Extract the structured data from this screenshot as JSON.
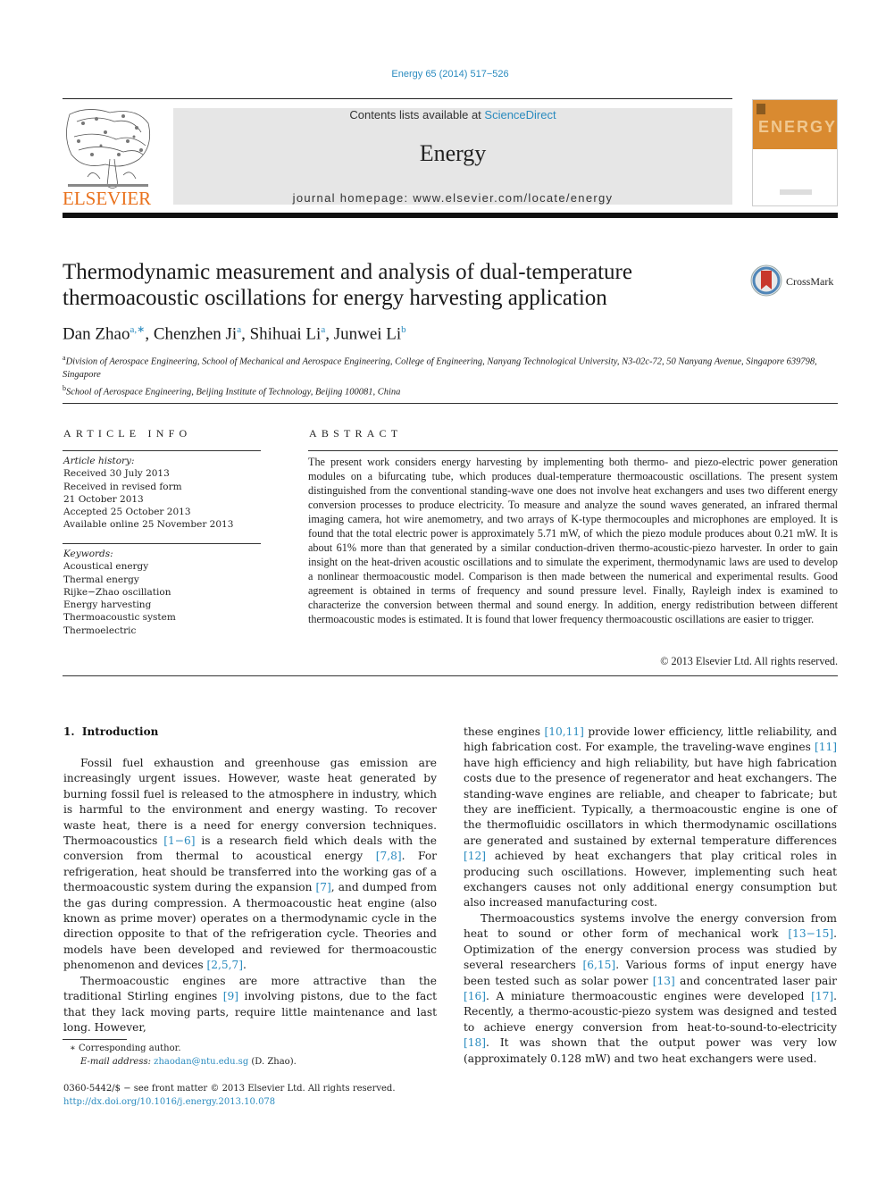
{
  "journal_ref": "Energy 65 (2014) 517−526",
  "masthead": {
    "contents_prefix": "Contents lists available at ",
    "contents_link": "ScienceDirect",
    "journal_name": "Energy",
    "homepage": "journal homepage: www.elsevier.com/locate/energy",
    "publisher": "ELSEVIER",
    "cover_word": "ENERGY",
    "brand_color": "#e9711c"
  },
  "crossmark_label": "CrossMark",
  "title": "Thermodynamic measurement and analysis of dual-temperature thermoacoustic oscillations for energy harvesting application",
  "authors": [
    {
      "name": "Dan Zhao",
      "sup": "a,∗",
      "sep": ", "
    },
    {
      "name": "Chenzhen Ji",
      "sup": "a",
      "sep": ", "
    },
    {
      "name": "Shihuai Li",
      "sup": "a",
      "sep": ", "
    },
    {
      "name": "Junwei Li",
      "sup": "b",
      "sep": ""
    }
  ],
  "affiliations": [
    {
      "sup": "a",
      "text": "Division of Aerospace Engineering, School of Mechanical and Aerospace Engineering, College of Engineering, Nanyang Technological University, N3-02c-72, 50 Nanyang Avenue, Singapore 639798, Singapore"
    },
    {
      "sup": "b",
      "text": "School of Aerospace Engineering, Beijing Institute of Technology, Beijing 100081, China"
    }
  ],
  "article_info": {
    "heading": "ARTICLE INFO",
    "history_label": "Article history:",
    "history": [
      "Received 30 July 2013",
      "Received in revised form",
      "21 October 2013",
      "Accepted 25 October 2013",
      "Available online 25 November 2013"
    ],
    "keywords_label": "Keywords:",
    "keywords": [
      "Acoustical energy",
      "Thermal energy",
      "Rijke−Zhao oscillation",
      "Energy harvesting",
      "Thermoacoustic system",
      "Thermoelectric"
    ]
  },
  "abstract": {
    "heading": "ABSTRACT",
    "text": "The present work considers energy harvesting by implementing both thermo- and piezo-electric power generation modules on a bifurcating tube, which produces dual-temperature thermoacoustic oscillations. The present system distinguished from the conventional standing-wave one does not involve heat exchangers and uses two different energy conversion processes to produce electricity. To measure and analyze the sound waves generated, an infrared thermal imaging camera, hot wire anemometry, and two arrays of K-type thermocouples and microphones are employed. It is found that the total electric power is approximately 5.71 mW, of which the piezo module produces about 0.21 mW. It is about 61% more than that generated by a similar conduction-driven thermo-acoustic-piezo harvester. In order to gain insight on the heat-driven acoustic oscillations and to simulate the experiment, thermodynamic laws are used to develop a nonlinear thermoacoustic model. Comparison is then made between the numerical and experimental results. Good agreement is obtained in terms of frequency and sound pressure level. Finally, Rayleigh index is examined to characterize the conversion between thermal and sound energy. In addition, energy redistribution between different thermoacoustic modes is estimated. It is found that lower frequency thermoacoustic oscillations are easier to trigger.",
    "copyright": "© 2013 Elsevier Ltd. All rights reserved."
  },
  "introduction": {
    "heading": "1.  Introduction",
    "left_paragraphs": [
      [
        {
          "t": "Fossil fuel exhaustion and greenhouse gas emission are increasingly urgent issues. However, waste heat generated by burning fossil fuel is released to the atmosphere in industry, which is harmful to the environment and energy wasting. To recover waste heat, there is a need for energy conversion techniques. Thermoacoustics "
        },
        {
          "r": "[1−6]"
        },
        {
          "t": " is a research field which deals with the conversion from thermal to acoustical energy "
        },
        {
          "r": "[7,8]"
        },
        {
          "t": ". For refrigeration, heat should be transferred into the working gas of a thermoacoustic system during the expansion "
        },
        {
          "r": "[7]"
        },
        {
          "t": ", and dumped from the gas during compression. A thermoacoustic heat engine (also known as prime mover) operates on a thermodynamic cycle in the direction opposite to that of the refrigeration cycle. Theories and models have been developed and reviewed for thermoacoustic phenomenon and devices "
        },
        {
          "r": "[2,5,7]"
        },
        {
          "t": "."
        }
      ],
      [
        {
          "t": "Thermoacoustic engines are more attractive than the traditional Stirling engines "
        },
        {
          "r": "[9]"
        },
        {
          "t": " involving pistons, due to the fact that they lack moving parts, require little maintenance and last long. However,"
        }
      ]
    ],
    "right_paragraphs": [
      [
        {
          "t": "these engines "
        },
        {
          "r": "[10,11]"
        },
        {
          "t": " provide lower efficiency, little reliability, and high fabrication cost. For example, the traveling-wave engines "
        },
        {
          "r": "[11]"
        },
        {
          "t": " have high efficiency and high reliability, but have high fabrication costs due to the presence of regenerator and heat exchangers. The standing-wave engines are reliable, and cheaper to fabricate; but they are inefficient. Typically, a thermoacoustic engine is one of the thermofluidic oscillators in which thermodynamic oscillations are generated and sustained by external temperature differences "
        },
        {
          "r": "[12]"
        },
        {
          "t": " achieved by heat exchangers that play critical roles in producing such oscillations. However, implementing such heat exchangers causes not only additional energy consumption but also increased manufacturing cost."
        }
      ],
      [
        {
          "t": "Thermoacoustics systems involve the energy conversion from heat to sound or other form of mechanical work "
        },
        {
          "r": "[13−15]"
        },
        {
          "t": ". Optimization of the energy conversion process was studied by several researchers "
        },
        {
          "r": "[6,15]"
        },
        {
          "t": ". Various forms of input energy have been tested such as solar power "
        },
        {
          "r": "[13]"
        },
        {
          "t": " and concentrated laser pair "
        },
        {
          "r": "[16]"
        },
        {
          "t": ". A miniature thermoacoustic engines were developed "
        },
        {
          "r": "[17]"
        },
        {
          "t": ". Recently, a thermo-acoustic-piezo system was designed and tested to achieve energy conversion from heat-to-sound-to-electricity "
        },
        {
          "r": "[18]"
        },
        {
          "t": ". It was shown that the output power was very low (approximately 0.128 mW) and two heat exchangers were used."
        }
      ]
    ]
  },
  "footnote": {
    "star": "∗",
    "corresponding": "Corresponding author.",
    "email_label": "E-mail address: ",
    "email": "zhaodan@ntu.edu.sg",
    "email_suffix": " (D. Zhao)."
  },
  "front_matter": {
    "issn_line": "0360-5442/$ − see front matter © 2013 Elsevier Ltd. All rights reserved.",
    "doi": "http://dx.doi.org/10.1016/j.energy.2013.10.078"
  }
}
